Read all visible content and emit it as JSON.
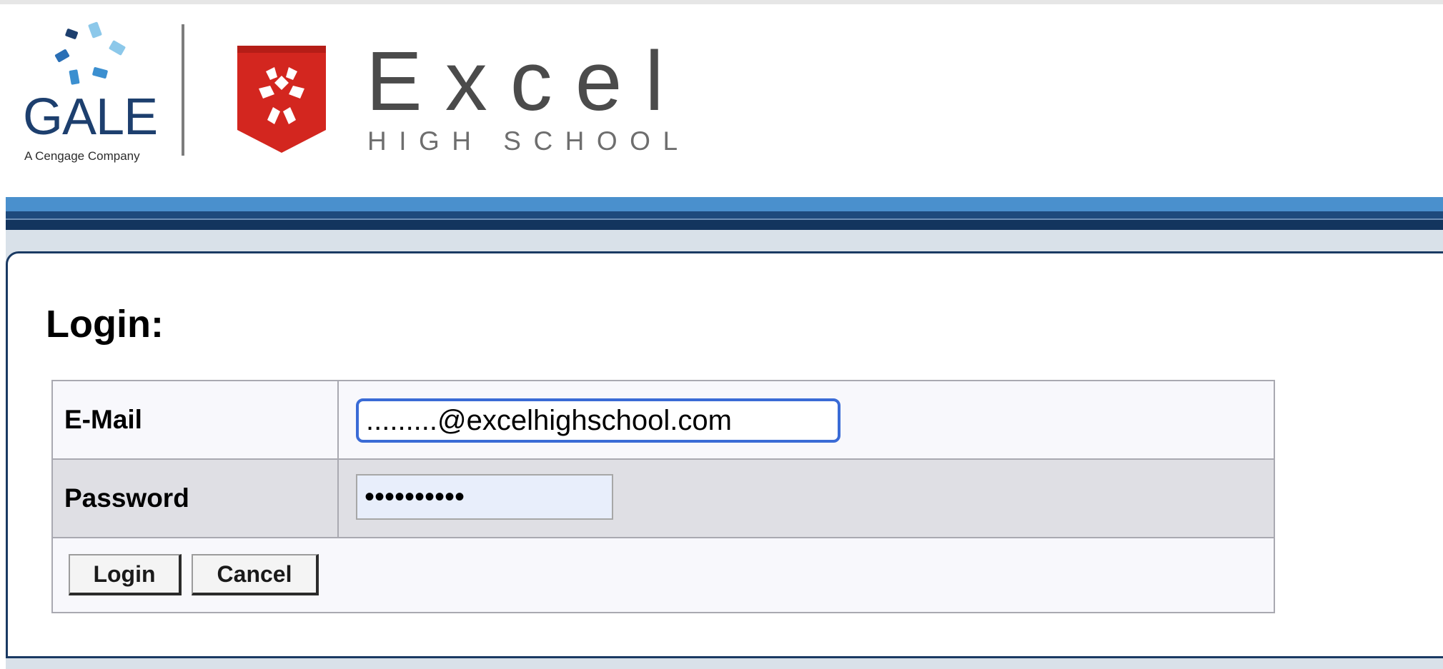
{
  "header": {
    "gale_logo": {
      "word": "GALE",
      "tagline": "A Cengage Company"
    },
    "school_logo": {
      "name": "Excel",
      "subtitle": "HIGH SCHOOL",
      "shield_color": "#d3261f"
    }
  },
  "colors": {
    "nav_light": "#4a90cd",
    "nav_dark": "#13355e",
    "panel_border": "#1a3a63",
    "focus_ring": "#3a6bd6"
  },
  "login": {
    "title": "Login:",
    "email_label": "E-Mail",
    "email_value": ".........@excelhighschool.com",
    "password_label": "Password",
    "password_value": "••••••••••",
    "login_button": "Login",
    "cancel_button": "Cancel"
  }
}
